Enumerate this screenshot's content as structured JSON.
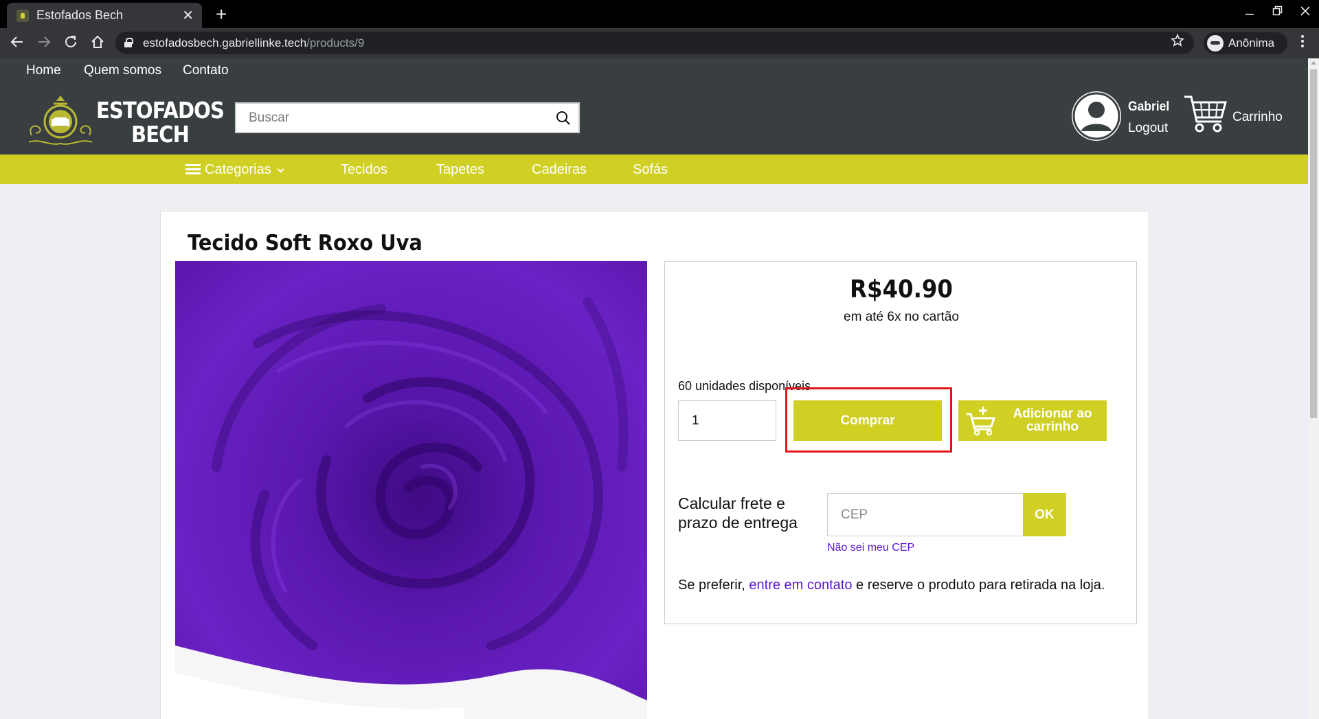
{
  "browser": {
    "tab_title": "Estofados Bech",
    "tab_close": "✕",
    "new_tab": "+",
    "url_host": "estofadosbech.gabriellinke.tech",
    "url_path": "/products/9",
    "profile_label": "Anônima",
    "icons": [
      "back-icon",
      "forward-icon",
      "reload-icon",
      "home-icon",
      "lock-icon",
      "star-icon",
      "incognito-icon",
      "kebab-menu-icon",
      "minimize-icon",
      "restore-icon",
      "close-window-icon"
    ]
  },
  "site": {
    "top_links": [
      "Home",
      "Quem somos",
      "Contato"
    ],
    "logo_line1": "ESTOFADOS",
    "logo_line2": "BECH",
    "search_placeholder": "Buscar",
    "user_name": "Gabriel",
    "logout_label": "Logout",
    "cart_label": "Carrinho",
    "categories_label": "Categorias",
    "nav_items": [
      "Tecidos",
      "Tapetes",
      "Cadeiras",
      "Sofás"
    ],
    "colors": {
      "header_bg": "#393e41",
      "accent": "#d0cf24",
      "link": "#5a16d6",
      "highlight": "#e2141b"
    }
  },
  "product": {
    "title": "Tecido Soft Roxo Uva",
    "image_alt": "purple soft fabric",
    "price": "R$40.90",
    "installments": "em até 6x no cartão",
    "stock": "60 unidades disponíveis",
    "quantity": "1",
    "buy_label": "Comprar",
    "add_cart_label": "Adicionar ao carrinho",
    "freight_label": "Calcular frete e prazo de entrega",
    "cep_placeholder": "CEP",
    "ok_label": "OK",
    "cep_help_link": "Não sei meu CEP",
    "pickup_before": "Se preferir,",
    "pickup_link": "entre em contato",
    "pickup_after": "e reserve o produto para retirada na loja."
  }
}
